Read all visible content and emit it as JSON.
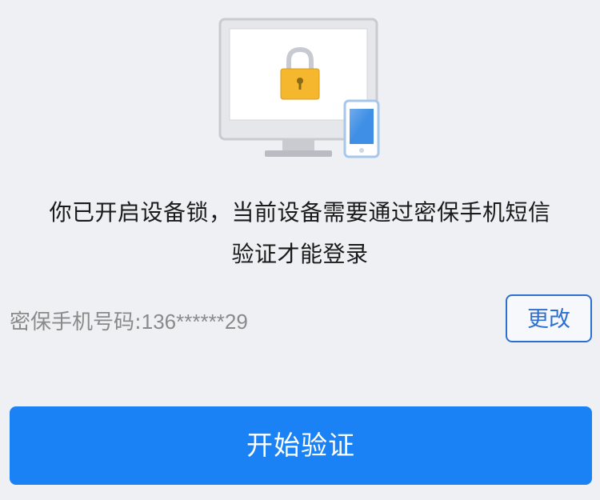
{
  "illustration": {
    "icon": "device-lock-icon"
  },
  "message": {
    "line1": "你已开启设备锁，当前设备需要通过密保手机短信",
    "line2": "验证才能登录"
  },
  "phone": {
    "label": "密保手机号码:",
    "value": "136******29"
  },
  "buttons": {
    "change_label": "更改",
    "start_label": "开始验证"
  },
  "colors": {
    "accent": "#1a82f5",
    "outline_button": "#2d6fd0",
    "background": "#eff0f4",
    "lock": "#f5b72e"
  }
}
